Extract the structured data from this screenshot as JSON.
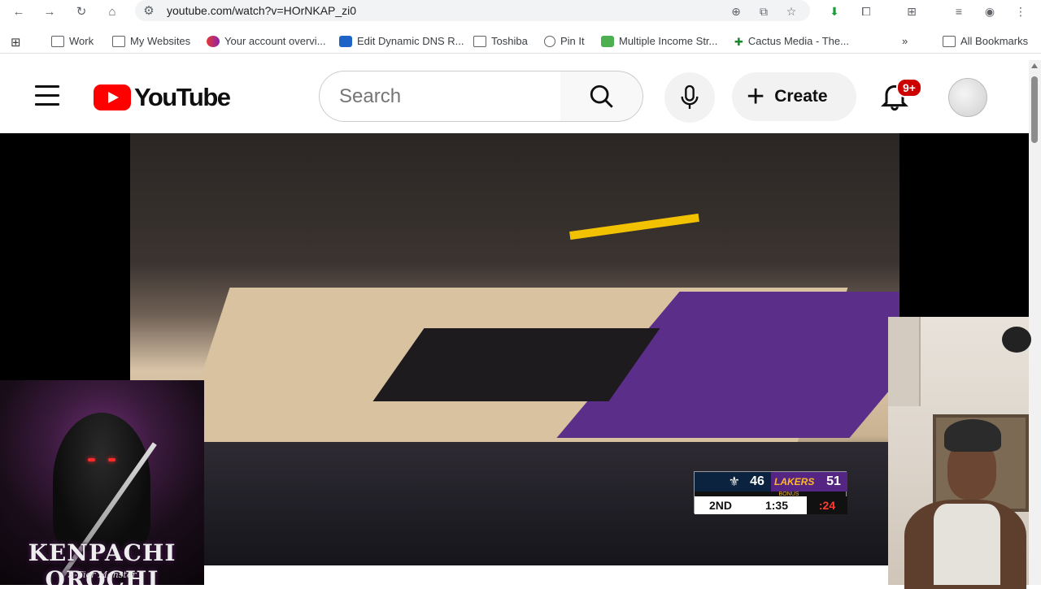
{
  "browser": {
    "url": "youtube.com/watch?v=HOrNKAP_zi0",
    "bookmarks": [
      {
        "label": "Work",
        "icon": "folder-icon"
      },
      {
        "label": "My Websites",
        "icon": "folder-icon"
      },
      {
        "label": "Your account overvi...",
        "icon": "site-icon"
      },
      {
        "label": "Edit Dynamic DNS R...",
        "icon": "site-icon"
      },
      {
        "label": "Toshiba",
        "icon": "folder-icon"
      },
      {
        "label": "Pin It",
        "icon": "site-icon"
      },
      {
        "label": "Multiple Income Str...",
        "icon": "site-icon"
      },
      {
        "label": "Cactus Media - The...",
        "icon": "cactus-icon"
      }
    ],
    "overflow": "»",
    "all_bookmarks": "All Bookmarks"
  },
  "youtube": {
    "logo_text": "YouTube",
    "search_placeholder": "Search",
    "create_label": "Create",
    "notification_count": "9+"
  },
  "scoreboard": {
    "team1_score": "46",
    "team2_name": "LAKERS",
    "team2_score": "51",
    "bonus": "BONUS",
    "quarter": "2ND",
    "clock": "1:35",
    "shot_clock": ":24"
  },
  "album": {
    "title": "KENPACHI OROCHI",
    "subtitle": "S-Tier Monster"
  }
}
